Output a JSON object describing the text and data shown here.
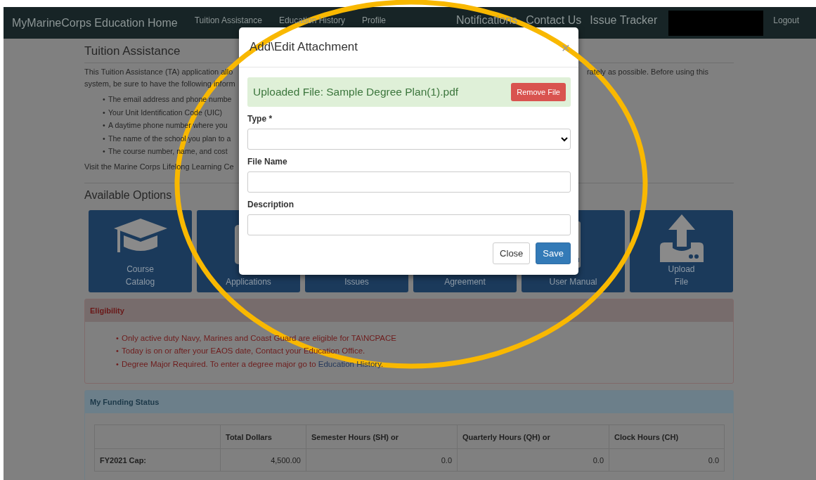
{
  "navbar": {
    "brand": "MyMarineCorps Education Home",
    "links": [
      {
        "label": "Tuition Assistance"
      },
      {
        "label": "Education History"
      },
      {
        "label": "Profile"
      }
    ],
    "right_links": [
      {
        "label": "Notifications"
      },
      {
        "label": "Contact Us"
      },
      {
        "label": "Issue Tracker"
      }
    ],
    "logout": "Logout"
  },
  "page": {
    "title": "Tuition Assistance",
    "intro_lines": [
      {
        "left": "This Tuition Assistance (TA) application allo",
        "right": "rately as possible. Before using this"
      },
      {
        "left": "system, be sure to have the following inform"
      }
    ],
    "bullet": "•",
    "requirements": [
      "The email address and phone numbe",
      "Your Unit Identification Code (UIC)",
      "A daytime phone number where you",
      "The name of the school you plan to a",
      "The course number, name, and cost"
    ],
    "visit_text": "Visit the Marine Corps Lifelong Learning Ce",
    "options_title": "Available Options",
    "tiles": [
      {
        "lines": [
          "Course",
          "Catalog"
        ]
      },
      {
        "lines": [
          "Applications"
        ]
      },
      {
        "lines": [
          "Issues"
        ]
      },
      {
        "lines": [
          "Agreement"
        ]
      },
      {
        "lines": [
          "User Manual"
        ]
      },
      {
        "lines": [
          "Upload",
          "File"
        ]
      }
    ]
  },
  "eligibility": {
    "title": "Eligibility",
    "items": [
      {
        "text": "Only active duty Navy, Marines and Coast Guard are eligible for TA\\NCPACE"
      },
      {
        "text": "Today is on or after your EAOS date, Contact your Education Office."
      },
      {
        "text": "Degree Major Required. To enter a degree major go to ",
        "link": "Education History",
        "after": "."
      }
    ]
  },
  "funding": {
    "title": "My Funding Status",
    "columns": [
      "",
      "Total Dollars",
      "Semester Hours (SH) or",
      "Quarterly Hours (QH) or",
      "Clock Hours (CH)"
    ],
    "rows": [
      [
        "FY2021 Cap:",
        "4,500.00",
        "0.0",
        "0.0",
        "0.0"
      ]
    ]
  },
  "modal": {
    "title": "Add\\Edit Attachment",
    "close_symbol": "×",
    "alert": "Uploaded File: Sample Degree Plan(1).pdf",
    "remove_button": "Remove File",
    "fields": [
      {
        "kind": "select",
        "label": "Type *"
      },
      {
        "kind": "text",
        "label": "File Name"
      },
      {
        "kind": "text",
        "label": "Description"
      }
    ],
    "buttons": [
      {
        "label": "Close",
        "kind": "default"
      },
      {
        "label": "Save",
        "kind": "primary"
      }
    ]
  }
}
